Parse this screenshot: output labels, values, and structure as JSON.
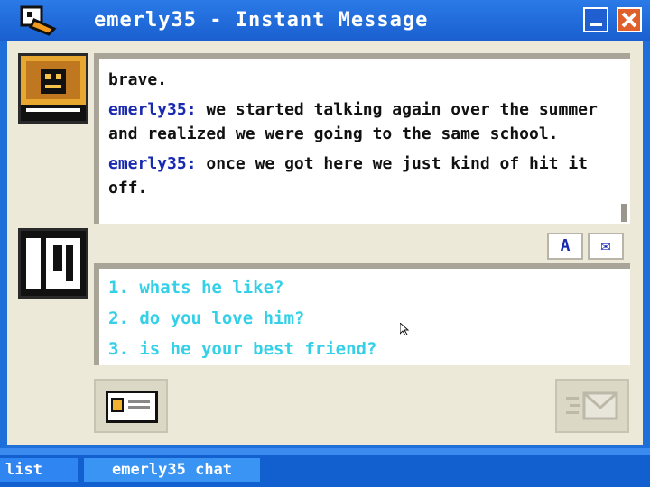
{
  "window": {
    "title": "emerly35 - Instant Message",
    "app_icon": "duck-head-icon",
    "minimize_icon": "minimize-icon",
    "close_icon": "close-icon"
  },
  "chat": {
    "messages": [
      {
        "sender": "",
        "text": "brave."
      },
      {
        "sender": "emerly35:",
        "text": " we started talking again over the summer and realized we were going to the same school."
      },
      {
        "sender": "emerly35:",
        "text": " once we got here we just kind of hit it off."
      }
    ]
  },
  "toolbar": {
    "font_label": "A",
    "envelope_label": "✉"
  },
  "options": [
    "1. whats he like?",
    "2. do you love him?",
    "3. is he your best friend?"
  ],
  "taskbar": {
    "list_label": "list",
    "chat_label": "emerly35 chat"
  },
  "colors": {
    "sender": "#1a2ab0",
    "option": "#33d0e8",
    "title_bar": "#1a5fcf",
    "panel": "#ece9d8"
  }
}
